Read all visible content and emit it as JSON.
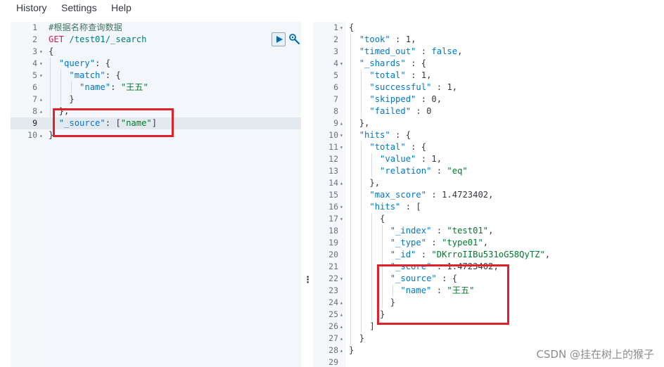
{
  "menu": [
    "History",
    "Settings",
    "Help"
  ],
  "request_lines": [
    {
      "n": "1",
      "fold": "",
      "html": "<span class='cm'>#根据名称查询数据</span>"
    },
    {
      "n": "2",
      "fold": "",
      "html": "<span class='method'>GET</span> <span class='url'>/test01/_search</span>"
    },
    {
      "n": "3",
      "fold": "▾",
      "html": "<span class='punc'>{</span>"
    },
    {
      "n": "4",
      "fold": "▾",
      "html": "  <span class='s'>\"query\"</span><span class='punc'>: {</span>"
    },
    {
      "n": "5",
      "fold": "▾",
      "html": "    <span class='s'>\"match\"</span><span class='punc'>: {</span>"
    },
    {
      "n": "6",
      "fold": "",
      "html": "      <span class='s'>\"name\"</span><span class='punc'>: </span><span class='str'>\"王五\"</span>"
    },
    {
      "n": "7",
      "fold": "▴",
      "html": "    <span class='punc'>}</span>"
    },
    {
      "n": "8",
      "fold": "▴",
      "html": "  <span class='punc'>},</span>"
    },
    {
      "n": "9",
      "fold": "",
      "html": "  <span class='s'>\"_source\"</span><span class='punc'>: [</span><span class='str'>\"name\"</span><span class='punc'>]</span>"
    },
    {
      "n": "10",
      "fold": "▴",
      "html": "<span class='punc'>}</span>"
    }
  ],
  "response_lines": [
    {
      "n": "1",
      "fold": "▾",
      "html": "<span class='punc'>{</span>"
    },
    {
      "n": "2",
      "fold": "",
      "html": "  <span class='s'>\"took\"</span><span class='punc'> : </span><span class='num'>1</span><span class='punc'>,</span>"
    },
    {
      "n": "3",
      "fold": "",
      "html": "  <span class='s'>\"timed_out\"</span><span class='punc'> : </span><span class='bool'>false</span><span class='punc'>,</span>"
    },
    {
      "n": "4",
      "fold": "▾",
      "html": "  <span class='s'>\"_shards\"</span><span class='punc'> : {</span>"
    },
    {
      "n": "5",
      "fold": "",
      "html": "    <span class='s'>\"total\"</span><span class='punc'> : </span><span class='num'>1</span><span class='punc'>,</span>"
    },
    {
      "n": "6",
      "fold": "",
      "html": "    <span class='s'>\"successful\"</span><span class='punc'> : </span><span class='num'>1</span><span class='punc'>,</span>"
    },
    {
      "n": "7",
      "fold": "",
      "html": "    <span class='s'>\"skipped\"</span><span class='punc'> : </span><span class='num'>0</span><span class='punc'>,</span>"
    },
    {
      "n": "8",
      "fold": "",
      "html": "    <span class='s'>\"failed\"</span><span class='punc'> : </span><span class='num'>0</span>"
    },
    {
      "n": "9",
      "fold": "▴",
      "html": "  <span class='punc'>},</span>"
    },
    {
      "n": "10",
      "fold": "▾",
      "html": "  <span class='s'>\"hits\"</span><span class='punc'> : {</span>"
    },
    {
      "n": "11",
      "fold": "▾",
      "html": "    <span class='s'>\"total\"</span><span class='punc'> : {</span>"
    },
    {
      "n": "12",
      "fold": "",
      "html": "      <span class='s'>\"value\"</span><span class='punc'> : </span><span class='num'>1</span><span class='punc'>,</span>"
    },
    {
      "n": "13",
      "fold": "",
      "html": "      <span class='s'>\"relation\"</span><span class='punc'> : </span><span class='str'>\"eq\"</span>"
    },
    {
      "n": "14",
      "fold": "▴",
      "html": "    <span class='punc'>},</span>"
    },
    {
      "n": "15",
      "fold": "",
      "html": "    <span class='s'>\"max_score\"</span><span class='punc'> : </span><span class='num'>1.4723402</span><span class='punc'>,</span>"
    },
    {
      "n": "16",
      "fold": "▾",
      "html": "    <span class='s'>\"hits\"</span><span class='punc'> : [</span>"
    },
    {
      "n": "17",
      "fold": "▾",
      "html": "      <span class='punc'>{</span>"
    },
    {
      "n": "18",
      "fold": "",
      "html": "        <span class='s'>\"_index\"</span><span class='punc'> : </span><span class='str'>\"test01\"</span><span class='punc'>,</span>"
    },
    {
      "n": "19",
      "fold": "",
      "html": "        <span class='s'>\"_type\"</span><span class='punc'> : </span><span class='str'>\"type01\"</span><span class='punc'>,</span>"
    },
    {
      "n": "20",
      "fold": "",
      "html": "        <span class='s'>\"_id\"</span><span class='punc'> : </span><span class='str'>\"DKrroIIBu531oG58QyTZ\"</span><span class='punc'>,</span>"
    },
    {
      "n": "21",
      "fold": "",
      "html": "        <span class='s'>\"_score\"</span><span class='punc'> : </span><span class='num'>1.4723402</span><span class='punc'>,</span>"
    },
    {
      "n": "22",
      "fold": "▾",
      "html": "        <span class='s'>\"_source\"</span><span class='punc'> : {</span>"
    },
    {
      "n": "23",
      "fold": "",
      "html": "          <span class='s'>\"name\"</span><span class='punc'> : </span><span class='str'>\"王五\"</span>"
    },
    {
      "n": "24",
      "fold": "▴",
      "html": "        <span class='punc'>}</span>"
    },
    {
      "n": "25",
      "fold": "▴",
      "html": "      <span class='punc'>}</span>"
    },
    {
      "n": "26",
      "fold": "▴",
      "html": "    <span class='punc'>]</span>"
    },
    {
      "n": "27",
      "fold": "▴",
      "html": "  <span class='punc'>}</span>"
    },
    {
      "n": "28",
      "fold": "▴",
      "html": "<span class='punc'>}</span>"
    },
    {
      "n": "29",
      "fold": "",
      "html": ""
    }
  ],
  "active_request_line": 9,
  "watermark": "CSDN @挂在树上的猴子",
  "colors": {
    "highlight": "#e0202a",
    "accent": "#006bb4"
  }
}
